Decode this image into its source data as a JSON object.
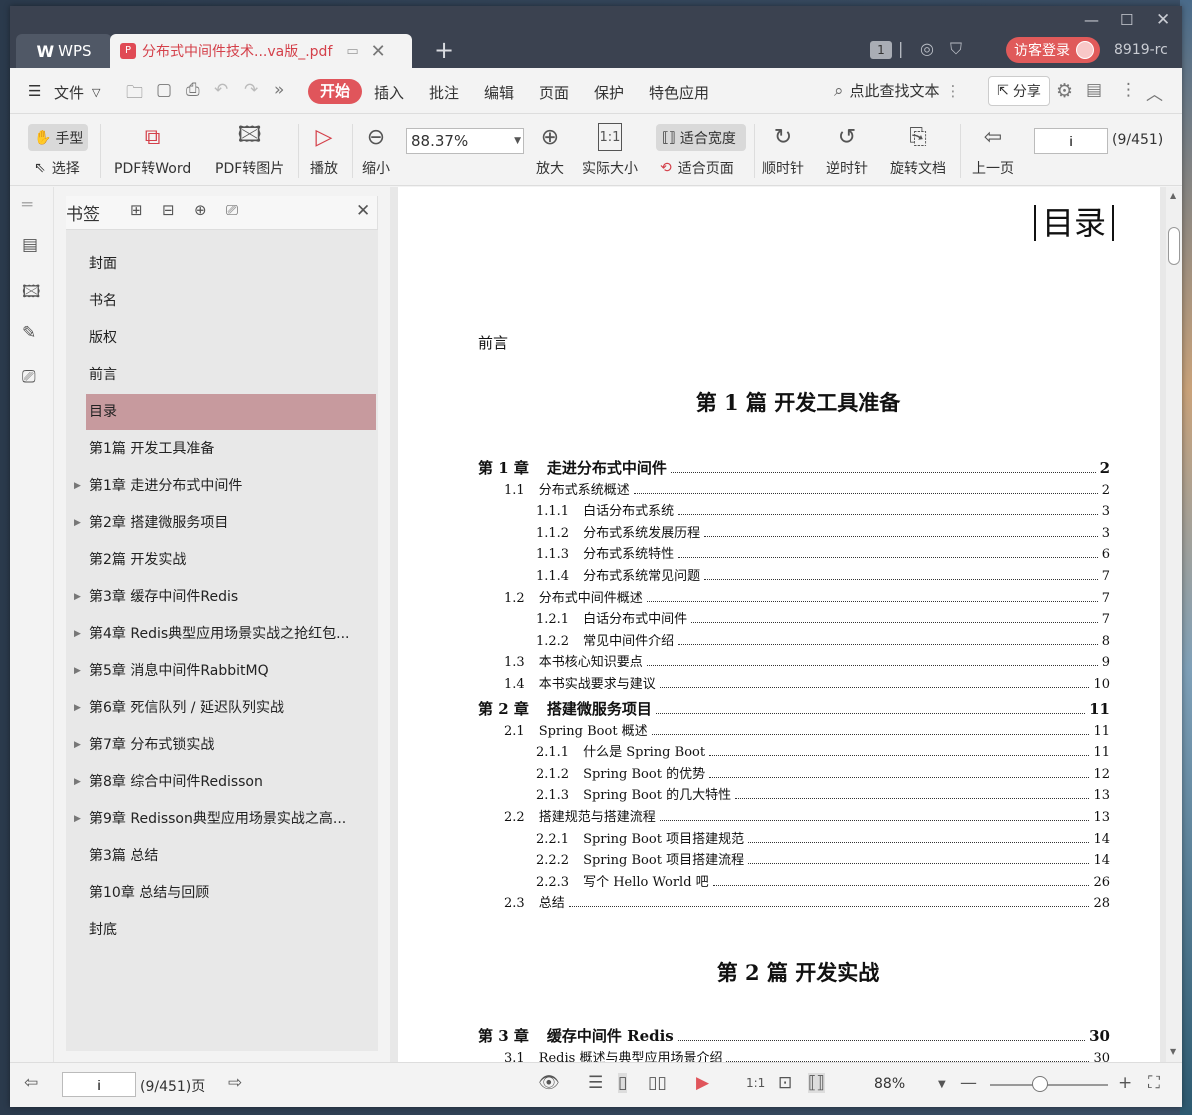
{
  "titlebar": {
    "wps_label": "WPS",
    "doc_tab_title": "分布式中间件技术...va版_.pdf",
    "badge_num": "1",
    "login_label": "访客登录",
    "user_id": "8919-rc"
  },
  "menubar": {
    "file_label": "文件",
    "tabs": [
      "开始",
      "插入",
      "批注",
      "编辑",
      "页面",
      "保护",
      "特色应用"
    ],
    "search_label": "点此查找文本",
    "share_label": "分享"
  },
  "toolbar": {
    "hand_label": "手型",
    "select_label": "选择",
    "pdf2word": "PDF转Word",
    "pdf2img": "PDF转图片",
    "play": "播放",
    "zoom_out": "缩小",
    "zoom_value": "88.37%",
    "zoom_in": "放大",
    "actual_size": "实际大小",
    "fit_width": "适合宽度",
    "fit_page": "适合页面",
    "clockwise": "顺时针",
    "counter_clockwise": "逆时针",
    "rotate_doc": "旋转文档",
    "prev_page": "上一页",
    "page_value": "i",
    "page_count": "(9/451)"
  },
  "bookmarks": {
    "title": "书签",
    "items": [
      {
        "label": "封面",
        "expandable": false
      },
      {
        "label": "书名",
        "expandable": false
      },
      {
        "label": "版权",
        "expandable": false
      },
      {
        "label": "前言",
        "expandable": false
      },
      {
        "label": "目录",
        "expandable": false,
        "active": true
      },
      {
        "label": "第1篇  开发工具准备",
        "expandable": false
      },
      {
        "label": "第1章  走进分布式中间件",
        "expandable": true
      },
      {
        "label": "第2章  搭建微服务项目",
        "expandable": true
      },
      {
        "label": "第2篇  开发实战",
        "expandable": false
      },
      {
        "label": "第3章  缓存中间件Redis",
        "expandable": true
      },
      {
        "label": "第4章  Redis典型应用场景实战之抢红包...",
        "expandable": true
      },
      {
        "label": "第5章  消息中间件RabbitMQ",
        "expandable": true
      },
      {
        "label": "第6章  死信队列 / 延迟队列实战",
        "expandable": true
      },
      {
        "label": "第7章  分布式锁实战",
        "expandable": true
      },
      {
        "label": "第8章  综合中间件Redisson",
        "expandable": true
      },
      {
        "label": "第9章  Redisson典型应用场景实战之高...",
        "expandable": true
      },
      {
        "label": "第3篇  总结",
        "expandable": false
      },
      {
        "label": "第10章  总结与回顾",
        "expandable": false
      },
      {
        "label": "封底",
        "expandable": false
      }
    ]
  },
  "document": {
    "header": "目录",
    "preface": "前言",
    "part1": "第 1 篇    开发工具准备",
    "part2": "第 2 篇    开发实战",
    "toc": [
      {
        "level": 0,
        "num": "第 1 章",
        "title": "走进分布式中间件",
        "page": "2"
      },
      {
        "level": 1,
        "num": "1.1",
        "title": "分布式系统概述",
        "page": "2"
      },
      {
        "level": 2,
        "num": "1.1.1",
        "title": "白话分布式系统",
        "page": "3"
      },
      {
        "level": 2,
        "num": "1.1.2",
        "title": "分布式系统发展历程",
        "page": "3"
      },
      {
        "level": 2,
        "num": "1.1.3",
        "title": "分布式系统特性",
        "page": "6"
      },
      {
        "level": 2,
        "num": "1.1.4",
        "title": "分布式系统常见问题",
        "page": "7"
      },
      {
        "level": 1,
        "num": "1.2",
        "title": "分布式中间件概述",
        "page": "7"
      },
      {
        "level": 2,
        "num": "1.2.1",
        "title": "白话分布式中间件",
        "page": "7"
      },
      {
        "level": 2,
        "num": "1.2.2",
        "title": "常见中间件介绍",
        "page": "8"
      },
      {
        "level": 1,
        "num": "1.3",
        "title": "本书核心知识要点",
        "page": "9"
      },
      {
        "level": 1,
        "num": "1.4",
        "title": "本书实战要求与建议",
        "page": "10"
      },
      {
        "level": 0,
        "num": "第 2 章",
        "title": "搭建微服务项目",
        "page": "11"
      },
      {
        "level": 1,
        "num": "2.1",
        "title": "Spring Boot 概述",
        "page": "11"
      },
      {
        "level": 2,
        "num": "2.1.1",
        "title": "什么是 Spring Boot",
        "page": "11"
      },
      {
        "level": 2,
        "num": "2.1.2",
        "title": "Spring Boot 的优势",
        "page": "12"
      },
      {
        "level": 2,
        "num": "2.1.3",
        "title": "Spring Boot 的几大特性",
        "page": "13"
      },
      {
        "level": 1,
        "num": "2.2",
        "title": "搭建规范与搭建流程",
        "page": "13"
      },
      {
        "level": 2,
        "num": "2.2.1",
        "title": "Spring Boot 项目搭建规范",
        "page": "14"
      },
      {
        "level": 2,
        "num": "2.2.2",
        "title": "Spring Boot 项目搭建流程",
        "page": "14"
      },
      {
        "level": 2,
        "num": "2.2.3",
        "title": "写个 Hello World 吧",
        "page": "26"
      },
      {
        "level": 1,
        "num": "2.3",
        "title": "总结",
        "page": "28"
      }
    ],
    "toc2": [
      {
        "level": 0,
        "num": "第 3 章",
        "title": "缓存中间件 Redis",
        "page": "30"
      },
      {
        "level": 1,
        "num": "3.1",
        "title": "Redis 概述与典型应用场景介绍",
        "page": "30"
      }
    ]
  },
  "statusbar": {
    "page_value": "i",
    "page_count": "(9/451)页",
    "zoom_pct": "88%"
  },
  "colors": {
    "accent": "#e0555b",
    "active_bookmark": "#c79a9e",
    "titlebar": "#3b4250"
  }
}
